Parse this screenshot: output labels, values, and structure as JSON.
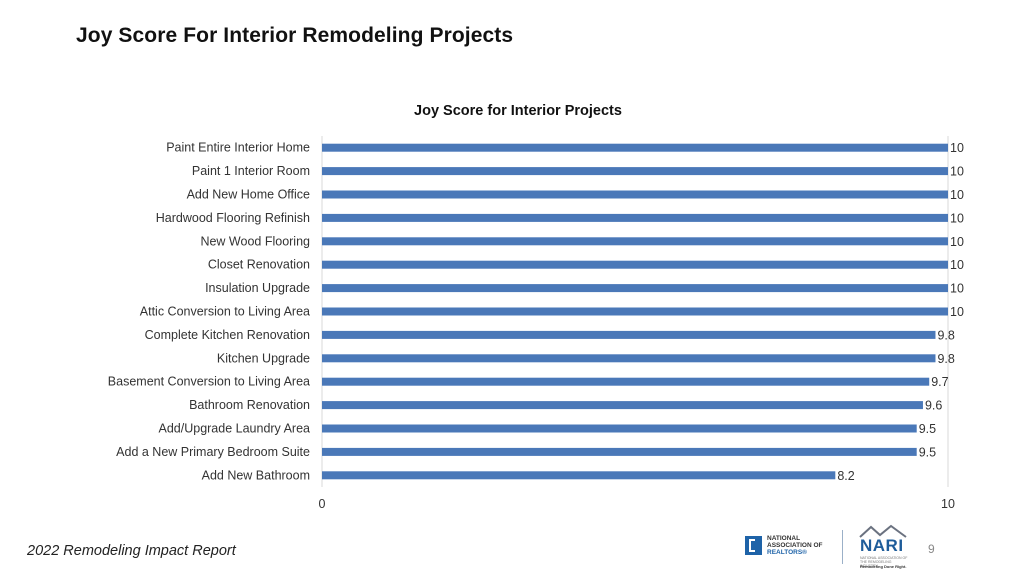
{
  "page": {
    "title": "Joy Score For Interior Remodeling Projects",
    "footer_report": "2022 Remodeling Impact Report",
    "page_number": "9",
    "logos": {
      "nar": {
        "line1": "NATIONAL",
        "line2": "ASSOCIATION OF",
        "line3": "REALTORS®"
      },
      "nari": {
        "word": "NARI",
        "subtitle": "NATIONAL ASSOCIATION OF THE REMODELING INDUSTRY",
        "tagline": "Remodeling Done Right."
      }
    }
  },
  "colors": {
    "bar": "#4a78b8",
    "axis": "#d9d9d9",
    "text": "#333333"
  },
  "chart_data": {
    "type": "bar",
    "orientation": "horizontal",
    "title": "Joy Score for Interior Projects",
    "xlabel": "",
    "ylabel": "",
    "xlim": [
      0,
      10
    ],
    "x_ticks": [
      "0",
      "10"
    ],
    "grid": false,
    "legend": "none",
    "categories": [
      "Paint Entire Interior Home",
      "Paint 1 Interior Room",
      "Add New Home Office",
      "Hardwood Flooring Refinish",
      "New Wood Flooring",
      "Closet Renovation",
      "Insulation Upgrade",
      "Attic Conversion to Living Area",
      "Complete Kitchen Renovation",
      "Kitchen Upgrade",
      "Basement Conversion to Living Area",
      "Bathroom Renovation",
      "Add/Upgrade Laundry Area",
      "Add a New Primary Bedroom Suite",
      "Add New Bathroom"
    ],
    "values": [
      10,
      10,
      10,
      10,
      10,
      10,
      10,
      10,
      9.8,
      9.8,
      9.7,
      9.6,
      9.5,
      9.5,
      8.2
    ],
    "data_labels": [
      "10",
      "10",
      "10",
      "10",
      "10",
      "10",
      "10",
      "10",
      "9.8",
      "9.8",
      "9.7",
      "9.6",
      "9.5",
      "9.5",
      "8.2"
    ]
  }
}
